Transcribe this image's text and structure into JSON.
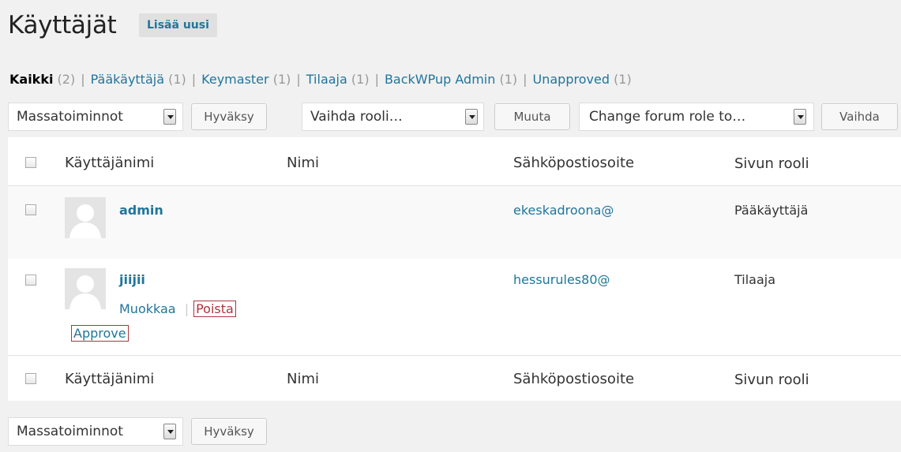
{
  "header": {
    "title": "Käyttäjät",
    "add_new": "Lisää uusi"
  },
  "filters": [
    {
      "label": "Kaikki",
      "count": "(2)"
    },
    {
      "label": "Pääkäyttäjä",
      "count": "(1)"
    },
    {
      "label": "Keymaster",
      "count": "(1)"
    },
    {
      "label": "Tilaaja",
      "count": "(1)"
    },
    {
      "label": "BackWPup Admin",
      "count": "(1)"
    },
    {
      "label": "Unapproved",
      "count": "(1)"
    }
  ],
  "separator": "|",
  "toolbar": {
    "bulk_select": "Massatoiminnot",
    "apply_button": "Hyväksy",
    "role_select": "Vaihda rooli…",
    "change_button": "Muuta",
    "forum_select": "Change forum role to…",
    "switch_button": "Vaihda"
  },
  "columns": {
    "username": "Käyttäjänimi",
    "name": "Nimi",
    "email": "Sähköpostiosoite",
    "role": "Sivun rooli"
  },
  "users": [
    {
      "username": "admin",
      "email": "ekeskadroona@",
      "role": "Pääkäyttäjä"
    },
    {
      "username": "jiijii",
      "email": "hessurules80@",
      "role": "Tilaaja",
      "actions": {
        "edit": "Muokkaa",
        "delete": "Poista",
        "approve": "Approve"
      }
    }
  ],
  "bottom_toolbar": {
    "bulk_select": "Massatoiminnot",
    "apply_button": "Hyväksy"
  }
}
